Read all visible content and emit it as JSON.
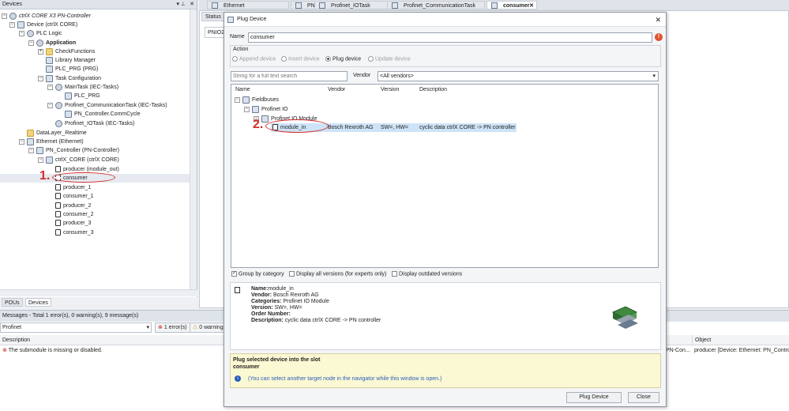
{
  "devices_panel": {
    "title": "Devices",
    "tree": [
      {
        "label": "ctrlX CORE X3 PN-Controller",
        "italic": true
      },
      {
        "label": "Device (ctrlX CORE)"
      },
      {
        "label": "PLC Logic"
      },
      {
        "label": "Application",
        "bold": true
      },
      {
        "label": "CheckFunctions"
      },
      {
        "label": "Library Manager"
      },
      {
        "label": "PLC_PRG (PRG)"
      },
      {
        "label": "Task Configuration"
      },
      {
        "label": "MainTask (IEC-Tasks)"
      },
      {
        "label": "PLC_PRG"
      },
      {
        "label": "Profinet_CommunicationTask (IEC-Tasks)"
      },
      {
        "label": "PN_Controller.CommCycle"
      },
      {
        "label": "Profinet_IOTask (IEC-Tasks)"
      },
      {
        "label": "DataLayer_Realtime"
      },
      {
        "label": "Ethernet (Ethernet)"
      },
      {
        "label": "PN_Controller (PN-Controller)"
      },
      {
        "label": "ctrlX_CORE (ctrlX CORE)"
      },
      {
        "label": "producer (module_out)"
      },
      {
        "label": "consumer"
      },
      {
        "label": "producer_1"
      },
      {
        "label": "consumer_1"
      },
      {
        "label": "producer_2"
      },
      {
        "label": "consumer_2"
      },
      {
        "label": "producer_3"
      },
      {
        "label": "consumer_3"
      }
    ],
    "bottom_tabs": [
      "POUs",
      "Devices"
    ]
  },
  "editor_tabs": [
    "Ethernet",
    "PN_Controller",
    "Profinet_IOTask",
    "Profinet_CommunicationTask",
    "consumer"
  ],
  "editor": {
    "status_tab": "Status",
    "pnio_label": "PNIO2"
  },
  "messages": {
    "header": "Messages - Total 1 error(s), 0 warning(s), 9 message(s)",
    "filter": "Profinet",
    "errors_btn": "1 error(s)",
    "warnings_btn": "0 warning",
    "col_description": "Description",
    "col_object": "Object",
    "row_description": "The submodule is missing or disabled.",
    "row_project_partial": "PN-Con...",
    "row_object": "producer [Device: Ethernet: PN_Controlle"
  },
  "dialog": {
    "title": "Plug Device",
    "name_label": "Name",
    "name_value": "consumer",
    "action_group": "Action",
    "actions": [
      "Append device",
      "Insert device",
      "Plug device",
      "Update device"
    ],
    "search_placeholder": "String for a full text search",
    "vendor_label": "Vendor",
    "vendor_value": "<All vendors>",
    "columns": [
      "Name",
      "Vendor",
      "Version",
      "Description"
    ],
    "tree": {
      "fieldbuses": "Fieldbuses",
      "profinet_io": "Profinet IO",
      "profinet_io_module": "Profinet IO Module",
      "row": {
        "name": "module_in",
        "vendor": "Bosch Rexroth AG",
        "version": "SW=, HW=",
        "description": "cyclic data ctrlX CORE -> PN controller"
      }
    },
    "options": [
      {
        "label": "Group by category",
        "checked": true
      },
      {
        "label": "Display all versions (for experts only)",
        "checked": false
      },
      {
        "label": "Display outdated versions",
        "checked": false
      }
    ],
    "info": {
      "name_k": "Name:",
      "name_v": "module_in",
      "vendor_k": "Vendor:",
      "vendor_v": "Bosch Rexroth AG",
      "categories_k": "Categories:",
      "categories_v": "Profinet IO Module",
      "version_k": "Version:",
      "version_v": "SW=, HW=",
      "order_k": "Order Number:",
      "order_v": "",
      "description_k": "Description:",
      "description_v": "cyclic data ctrlX CORE -> PN controller"
    },
    "hint_title": "Plug selected device into the slot",
    "hint_slot": "consumer",
    "hint_note": "(You can select another target node in the navigator while this window is open.)",
    "plug_button": "Plug Device",
    "close_button": "Close"
  },
  "annotations": {
    "one": "1.",
    "two": "2."
  },
  "colors": {
    "selection": "#cde3f7",
    "annotation": "#d42a2a",
    "hint_bg": "#fbf8d4"
  }
}
